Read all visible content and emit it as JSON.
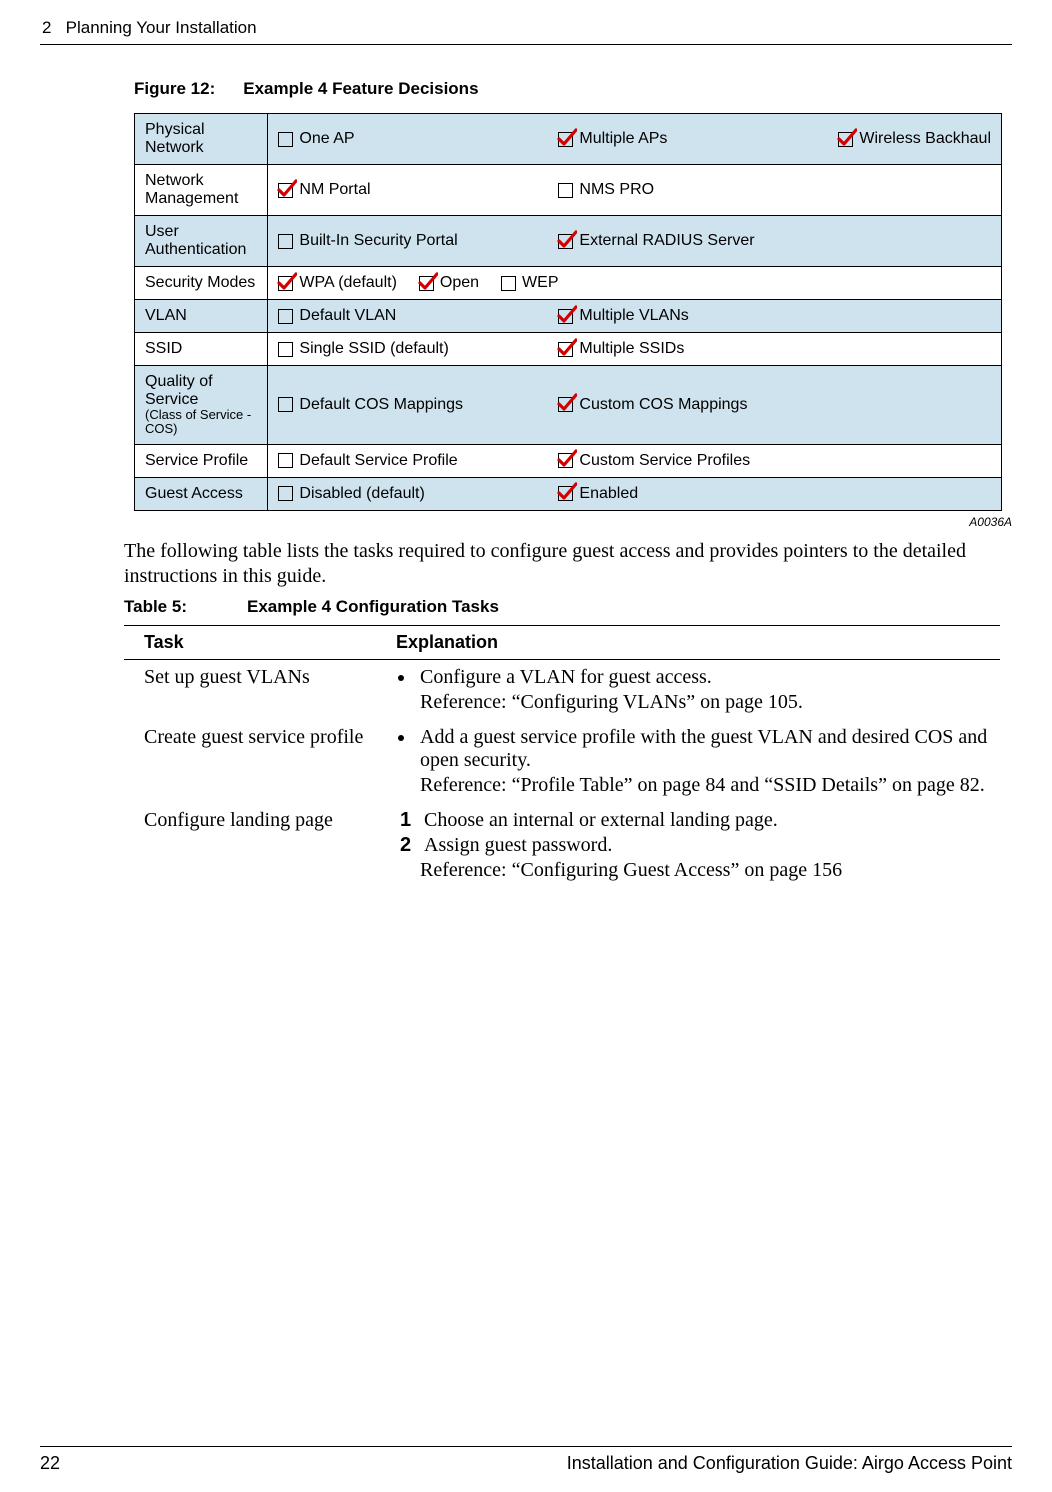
{
  "header": {
    "chapter_num": "2",
    "chapter_title": "Planning Your Installation"
  },
  "figure": {
    "label": "Figure 12:",
    "title": "Example 4 Feature Decisions",
    "ref": "A0036A",
    "rows": [
      {
        "label": "Physical Network",
        "shaded": true,
        "options": [
          {
            "text": "One AP",
            "checked": false
          },
          {
            "text": "Multiple APs",
            "checked": true
          },
          {
            "text": "Wireless Backhaul",
            "checked": true
          }
        ]
      },
      {
        "label": "Network Management",
        "shaded": false,
        "options": [
          {
            "text": "NM Portal",
            "checked": true
          },
          {
            "text": "NMS PRO",
            "checked": false
          }
        ]
      },
      {
        "label": "User Authentication",
        "shaded": true,
        "options": [
          {
            "text": "Built-In Security Portal",
            "checked": false
          },
          {
            "text": "External RADIUS Server",
            "checked": true
          }
        ]
      },
      {
        "label": "Security Modes",
        "shaded": false,
        "options": [
          {
            "text": "WPA (default)",
            "checked": true
          },
          {
            "text": "Open",
            "checked": true
          },
          {
            "text": "WEP",
            "checked": false
          }
        ]
      },
      {
        "label": "VLAN",
        "shaded": true,
        "options": [
          {
            "text": "Default VLAN",
            "checked": false
          },
          {
            "text": "Multiple VLANs",
            "checked": true
          }
        ]
      },
      {
        "label": "SSID",
        "shaded": false,
        "options": [
          {
            "text": "Single SSID (default)",
            "checked": false
          },
          {
            "text": "Multiple SSIDs",
            "checked": true
          }
        ]
      },
      {
        "label": "Quality of Service",
        "sublabel": "(Class of Service - COS)",
        "shaded": true,
        "options": [
          {
            "text": "Default COS Mappings",
            "checked": false
          },
          {
            "text": "Custom COS Mappings",
            "checked": true
          }
        ]
      },
      {
        "label": "Service Profile",
        "shaded": false,
        "options": [
          {
            "text": "Default Service Profile",
            "checked": false
          },
          {
            "text": "Custom Service Profiles",
            "checked": true
          }
        ]
      },
      {
        "label": "Guest Access",
        "shaded": true,
        "options": [
          {
            "text": "Disabled (default)",
            "checked": false
          },
          {
            "text": "Enabled",
            "checked": true
          }
        ]
      }
    ]
  },
  "paragraph": "The following table lists the tasks required to configure guest access and provides pointers to the detailed instructions in this guide.",
  "table": {
    "label": "Table 5:",
    "title": "Example 4 Configuration Tasks",
    "headers": {
      "task": "Task",
      "explanation": "Explanation"
    },
    "rows": [
      {
        "task": "Set up guest VLANs",
        "bullets": [
          "Configure a VLAN for guest access."
        ],
        "reference": "Reference: “Configuring VLANs” on page 105."
      },
      {
        "task": "Create guest service profile",
        "bullets": [
          "Add a guest service profile with the guest VLAN and desired COS and open security."
        ],
        "reference": "Reference: “Profile Table” on page 84 and “SSID Details” on page 82."
      },
      {
        "task": "Configure landing page",
        "numbered": [
          "Choose an internal or external landing page.",
          "Assign guest password."
        ],
        "reference": "Reference: “Configuring Guest Access” on page 156"
      }
    ]
  },
  "footer": {
    "page": "22",
    "doc": "Installation and Configuration Guide: Airgo Access Point"
  }
}
